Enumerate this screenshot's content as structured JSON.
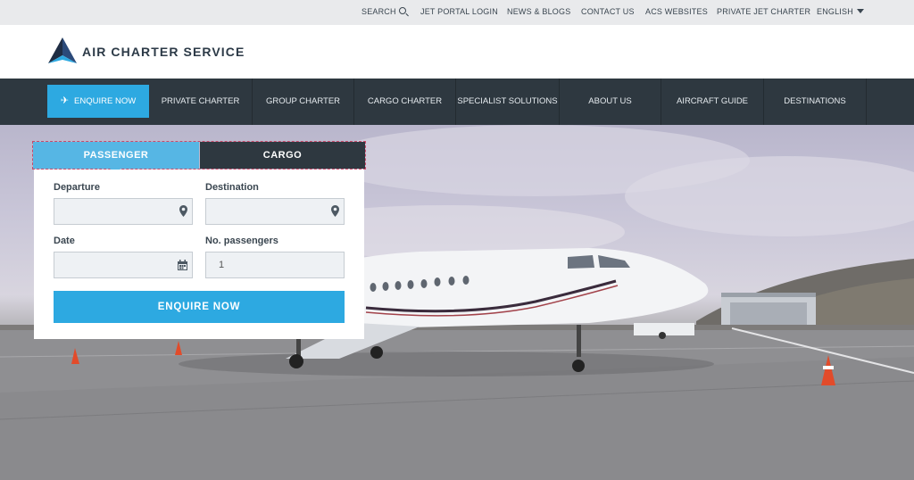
{
  "topbar": {
    "search": "SEARCH",
    "jet_portal": "JET PORTAL LOGIN",
    "news": "NEWS & BLOGS",
    "contact": "CONTACT US",
    "websites": "ACS WEBSITES",
    "private_jet": "PRIVATE JET CHARTER",
    "language": "ENGLISH"
  },
  "brand": {
    "name": "AIR CHARTER SERVICE",
    "colors": {
      "navy": "#2c3a47",
      "accent": "#2da9e1"
    }
  },
  "nav": {
    "enquire": "ENQUIRE NOW",
    "items": [
      "PRIVATE CHARTER",
      "GROUP CHARTER",
      "CARGO CHARTER",
      "SPECIALIST SOLUTIONS",
      "ABOUT US",
      "AIRCRAFT GUIDE",
      "DESTINATIONS"
    ]
  },
  "booking": {
    "tabs": {
      "passenger": "PASSENGER",
      "cargo": "CARGO"
    },
    "departure_label": "Departure",
    "destination_label": "Destination",
    "date_label": "Date",
    "passengers_label": "No. passengers",
    "passengers_value": "1",
    "submit": "ENQUIRE NOW"
  },
  "icons": {
    "search": "search-icon",
    "language_dropdown": "caret-down-icon",
    "enquire": "plane-icon",
    "location": "map-pin-icon",
    "date": "calendar-icon"
  }
}
